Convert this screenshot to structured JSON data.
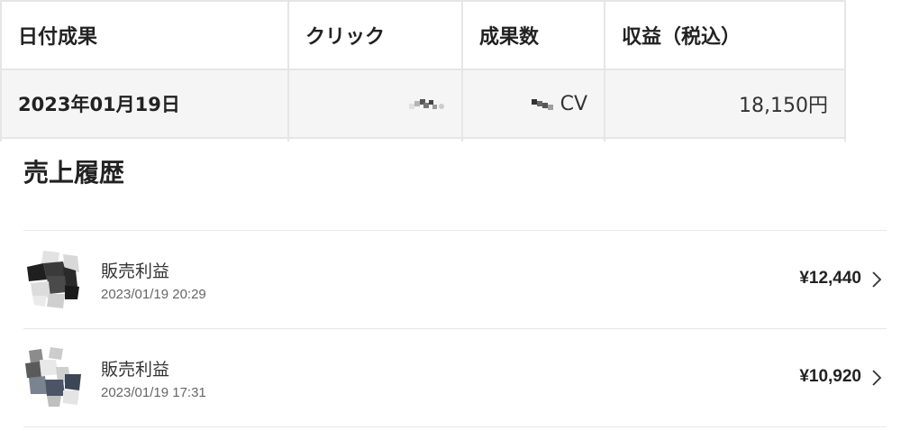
{
  "summary_table": {
    "headers": [
      "日付成果",
      "クリック",
      "成果数",
      "収益（税込）"
    ],
    "row": {
      "date": "2023年01月19日",
      "clicks_masked_icon": "pixelated-mask",
      "conversions_masked_icon": "pixelated-mask",
      "conversions_unit": "CV",
      "revenue": "18,150円"
    }
  },
  "history": {
    "title": "売上履歴",
    "items": [
      {
        "label": "販売利益",
        "timestamp": "2023/01/19 20:29",
        "amount": "¥12,440",
        "avatar_icon": "pixelated-avatar"
      },
      {
        "label": "販売利益",
        "timestamp": "2023/01/19 17:31",
        "amount": "¥10,920",
        "avatar_icon": "pixelated-avatar"
      }
    ]
  },
  "colors": {
    "border": "#e6e6e6",
    "row_background": "#f5f5f5",
    "text": "#222222",
    "subtext": "#666666"
  }
}
